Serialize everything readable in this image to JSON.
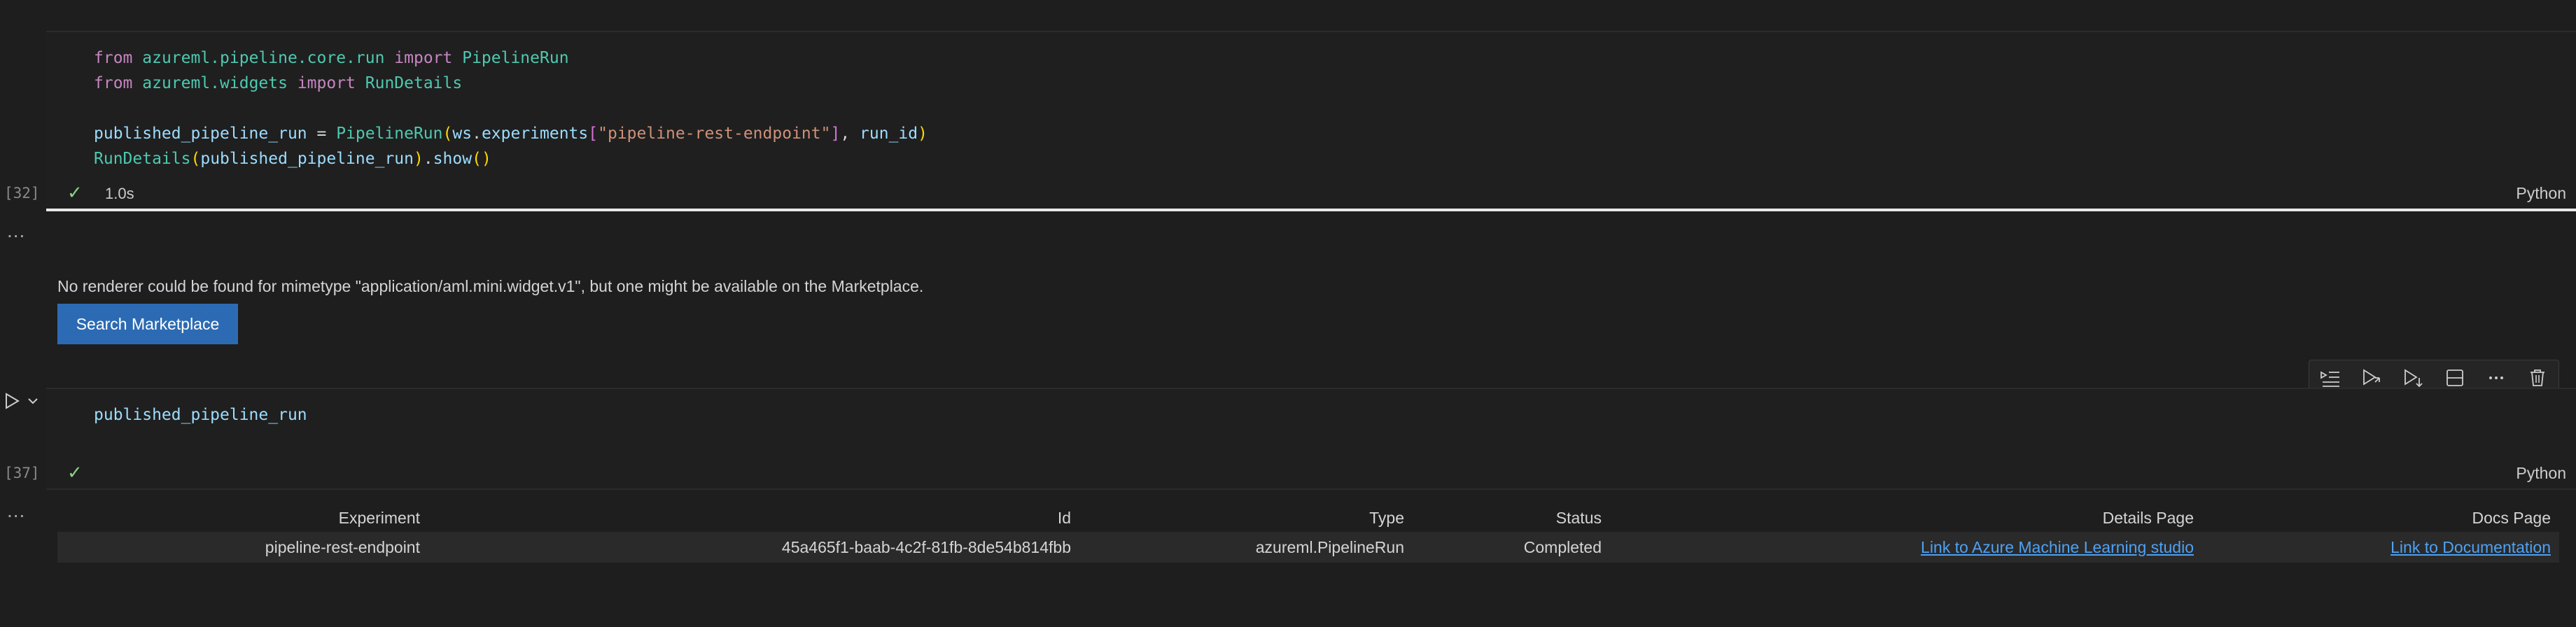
{
  "cell1": {
    "code_lines": [
      [
        {
          "t": "from ",
          "c": "kw"
        },
        {
          "t": "azureml.pipeline.core.run ",
          "c": "mod"
        },
        {
          "t": "import ",
          "c": "kw"
        },
        {
          "t": "PipelineRun",
          "c": "cls"
        }
      ],
      [
        {
          "t": "from ",
          "c": "kw"
        },
        {
          "t": "azureml.widgets ",
          "c": "mod"
        },
        {
          "t": "import ",
          "c": "kw"
        },
        {
          "t": "RunDetails",
          "c": "cls"
        }
      ],
      [],
      [
        {
          "t": "published_pipeline_run",
          "c": "var"
        },
        {
          "t": " = ",
          "c": "plain"
        },
        {
          "t": "PipelineRun",
          "c": "cls"
        },
        {
          "t": "(",
          "c": "br1"
        },
        {
          "t": "ws",
          "c": "var"
        },
        {
          "t": ".",
          "c": "plain"
        },
        {
          "t": "experiments",
          "c": "var"
        },
        {
          "t": "[",
          "c": "br2"
        },
        {
          "t": "\"pipeline-rest-endpoint\"",
          "c": "str"
        },
        {
          "t": "]",
          "c": "br2"
        },
        {
          "t": ", ",
          "c": "plain"
        },
        {
          "t": "run_id",
          "c": "var"
        },
        {
          "t": ")",
          "c": "br1"
        }
      ],
      [
        {
          "t": "RunDetails",
          "c": "cls"
        },
        {
          "t": "(",
          "c": "br1"
        },
        {
          "t": "published_pipeline_run",
          "c": "var"
        },
        {
          "t": ")",
          "c": "br1"
        },
        {
          "t": ".",
          "c": "plain"
        },
        {
          "t": "show",
          "c": "var"
        },
        {
          "t": "()",
          "c": "br1"
        }
      ]
    ],
    "exec_count": "[32]",
    "status_time": "1.0s",
    "language": "Python"
  },
  "output1": {
    "message": "No renderer could be found for mimetype \"application/aml.mini.widget.v1\", but one might be available on the Marketplace.",
    "button_label": "Search Marketplace",
    "more_glyph": "..."
  },
  "cell2": {
    "code": "published_pipeline_run",
    "exec_count": "[37]",
    "language": "Python",
    "more_glyph": "..."
  },
  "table": {
    "headers": [
      "Experiment",
      "Id",
      "Type",
      "Status",
      "Details Page",
      "Docs Page"
    ],
    "row": {
      "experiment": "pipeline-rest-endpoint",
      "id": "45a465f1-baab-4c2f-81fb-8de54b814fbb",
      "type": "azureml.PipelineRun",
      "status": "Completed",
      "details_link": "Link to Azure Machine Learning studio",
      "docs_link": "Link to Documentation"
    }
  },
  "toolbar_icons": [
    "execute-above-icon",
    "execute-cell-below-icon",
    "execute-below-icon",
    "split-cell-icon",
    "more-actions-icon",
    "delete-cell-icon"
  ],
  "colors": {
    "background": "#1e1e1e",
    "accent_button": "#2c6bb3",
    "link": "#4ea1f3",
    "success_check": "#89d185"
  }
}
